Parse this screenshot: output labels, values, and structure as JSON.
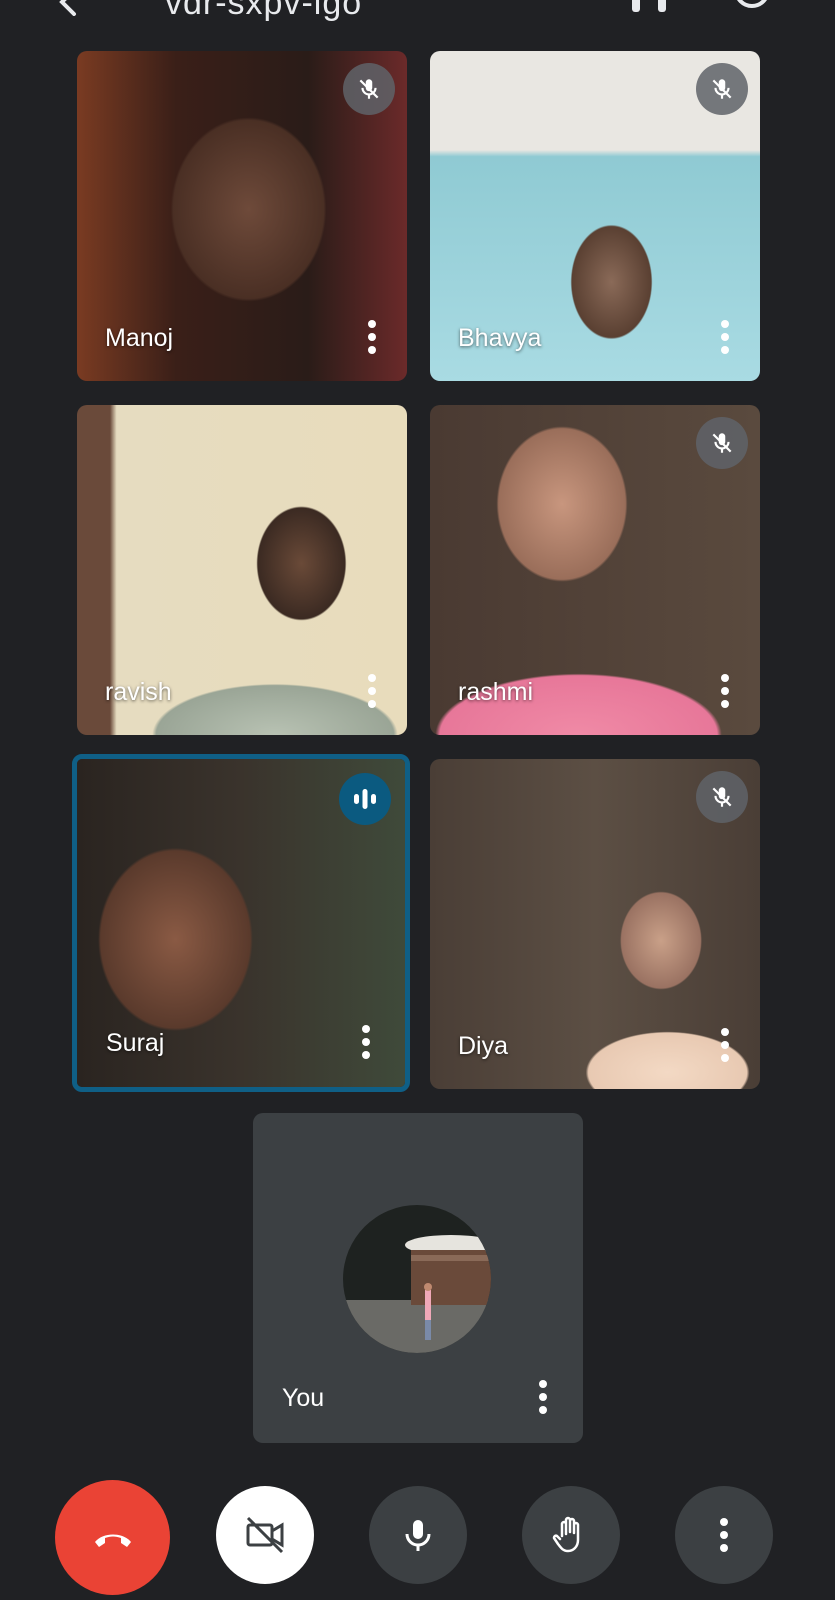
{
  "meeting": {
    "code": "vdr-sxpv-igo"
  },
  "participants": [
    {
      "name": "Manoj",
      "muted": true,
      "speaking": false
    },
    {
      "name": "Bhavya",
      "muted": true,
      "speaking": false
    },
    {
      "name": "ravish",
      "muted": false,
      "speaking": false
    },
    {
      "name": "rashmi",
      "muted": true,
      "speaking": false
    },
    {
      "name": "Suraj",
      "muted": false,
      "speaking": true
    },
    {
      "name": "Diya",
      "muted": true,
      "speaking": false
    }
  ],
  "self": {
    "name": "You"
  },
  "controls": {
    "end_call": "end-call",
    "camera": "camera-off",
    "microphone": "microphone-on",
    "raise_hand": "raise-hand",
    "more": "more-options"
  },
  "colors": {
    "background": "#202124",
    "tile_dark": "#3c4043",
    "end_call": "#ea4335",
    "speaking_accent": "#0b5a80"
  }
}
